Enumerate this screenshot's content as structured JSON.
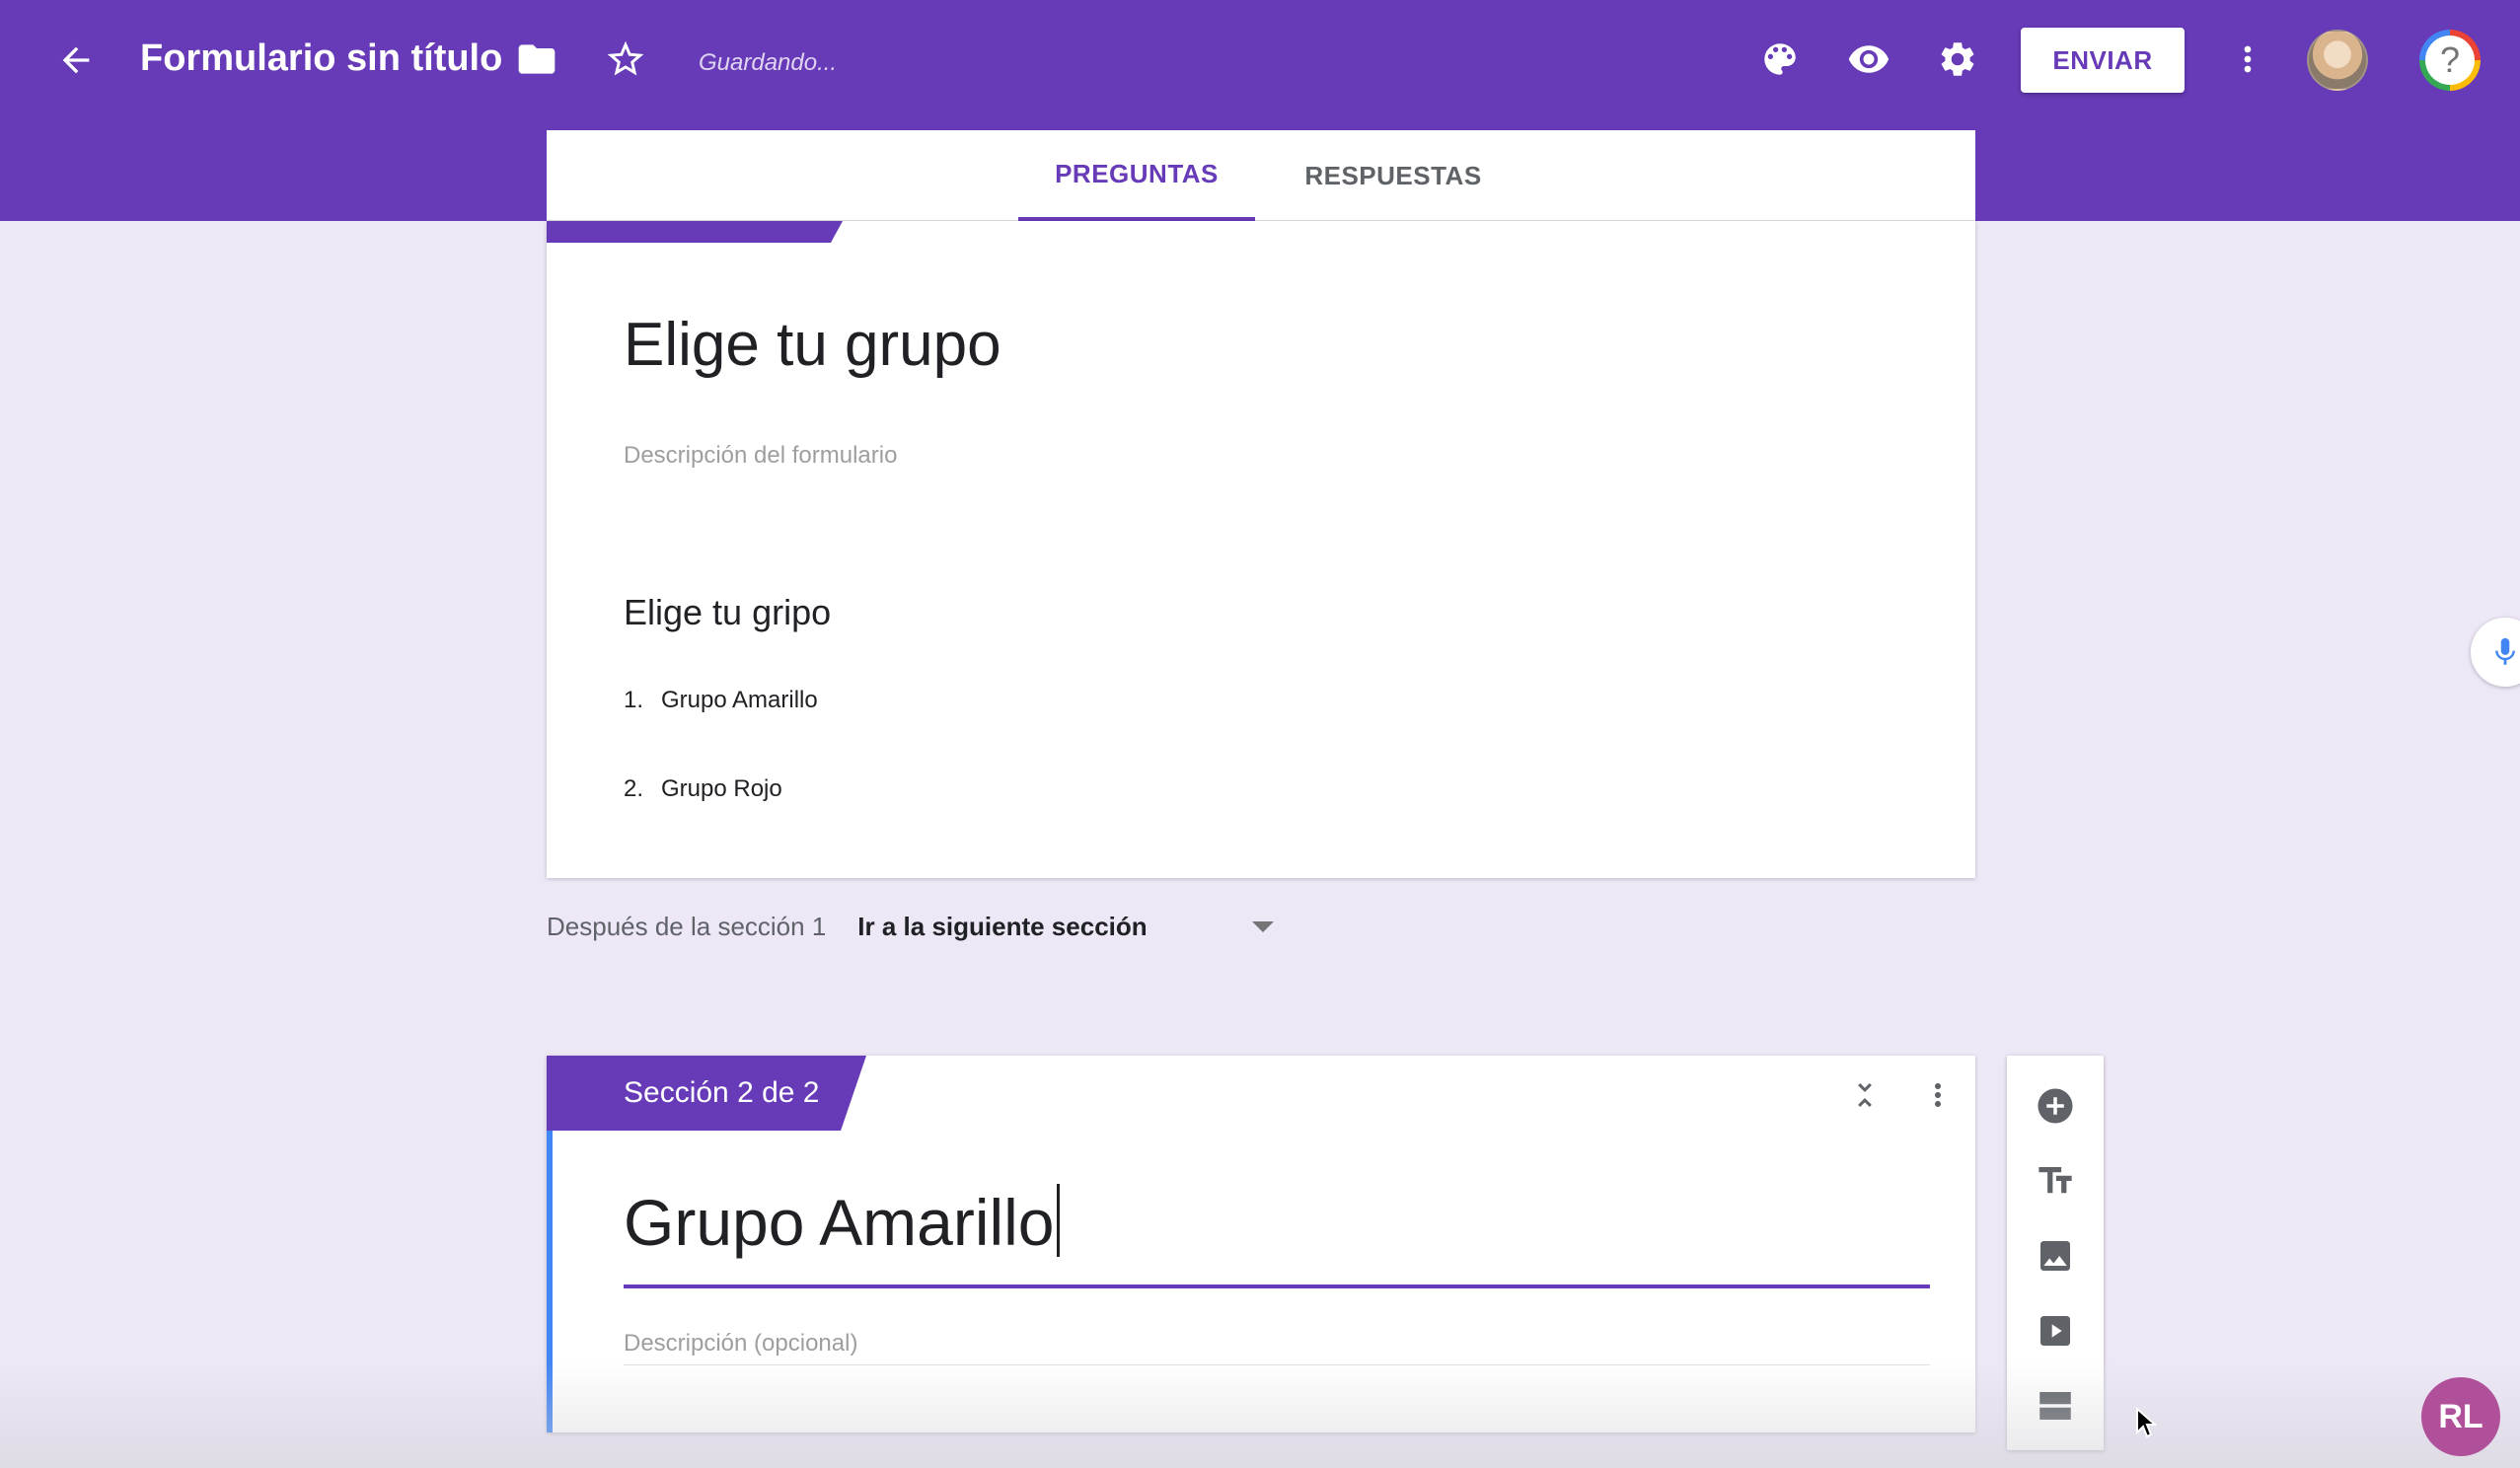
{
  "header": {
    "title": "Formulario sin título",
    "status": "Guardando...",
    "send_label": "ENVIAR",
    "icons": [
      "back-arrow-icon",
      "folder-icon",
      "star-icon",
      "palette-icon",
      "eye-icon",
      "gear-icon",
      "more-vert-icon",
      "avatar",
      "help-icon"
    ],
    "colors": {
      "primary": "#673ab7",
      "background": "#ede7f6"
    }
  },
  "tabs": [
    {
      "label": "PREGUNTAS",
      "active": true
    },
    {
      "label": "RESPUESTAS",
      "active": false
    }
  ],
  "section1": {
    "title": "Elige tu grupo",
    "description_placeholder": "Descripción del formulario",
    "question": "Elige tu gripo",
    "options": [
      {
        "num": "1.",
        "label": "Grupo Amarillo"
      },
      {
        "num": "2.",
        "label": "Grupo Rojo"
      }
    ]
  },
  "after_section": {
    "label": "Después de la sección 1",
    "value": "Ir a la siguiente sección"
  },
  "section2": {
    "badge": "Sección 2 de 2",
    "title": "Grupo Amarillo",
    "description_placeholder": "Descripción (opcional)"
  },
  "toolbar": [
    "add-question-icon",
    "add-title-icon",
    "add-image-icon",
    "add-video-icon",
    "add-section-icon"
  ],
  "watermark": "RL"
}
